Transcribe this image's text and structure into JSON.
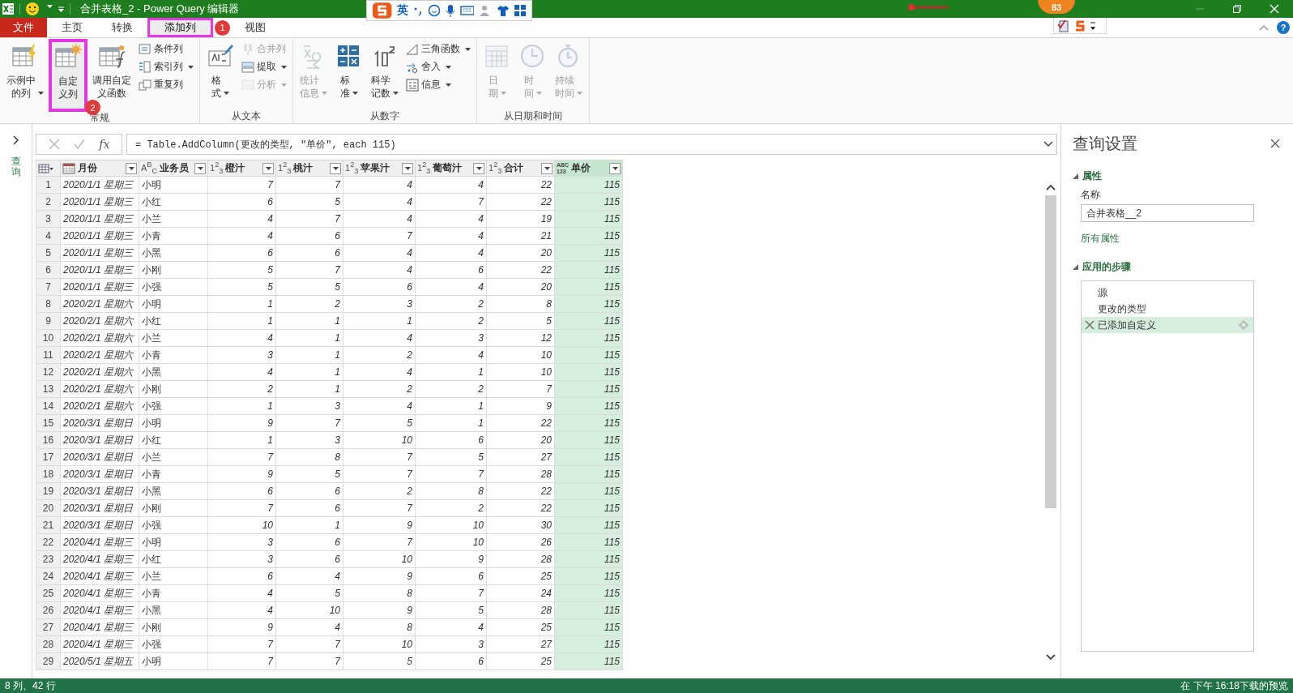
{
  "title_bar": {
    "title": "合并表格_2 - Power Query 编辑器",
    "ime_label": "英",
    "balloon": "83"
  },
  "tabs": [
    {
      "label": "文件",
      "kind": "file",
      "selected": false
    },
    {
      "label": "主页",
      "kind": "tab",
      "selected": false
    },
    {
      "label": "转换",
      "kind": "tab",
      "selected": false
    },
    {
      "label": "添加列",
      "kind": "tab",
      "selected": true,
      "callout": "1"
    },
    {
      "label": "视图",
      "kind": "tab",
      "selected": false
    }
  ],
  "help": "?",
  "ribbon": {
    "groups": [
      {
        "label": "常规",
        "items": [
          {
            "kind": "large",
            "label": "示例中的列",
            "dropdown": true,
            "disabled": false
          },
          {
            "kind": "large",
            "label": "自定义列",
            "dropdown": false,
            "disabled": false,
            "callout": "2"
          },
          {
            "kind": "large",
            "label": "调用自定义函数",
            "dropdown": false,
            "disabled": false
          },
          {
            "kind": "small",
            "label": "条件列",
            "dropdown": false,
            "disabled": false
          },
          {
            "kind": "small",
            "label": "索引列",
            "dropdown": true,
            "disabled": false
          },
          {
            "kind": "small",
            "label": "重复列",
            "dropdown": false,
            "disabled": false
          }
        ]
      },
      {
        "label": "从文本",
        "items": [
          {
            "kind": "large",
            "label": "格式",
            "dropdown": true,
            "disabled": false
          },
          {
            "kind": "small",
            "label": "合并列",
            "dropdown": false,
            "disabled": true
          },
          {
            "kind": "small",
            "label": "提取",
            "dropdown": true,
            "disabled": false
          },
          {
            "kind": "small",
            "label": "分析",
            "dropdown": true,
            "disabled": true
          }
        ]
      },
      {
        "label": "从数字",
        "items": [
          {
            "kind": "large",
            "label": "统计信息",
            "dropdown": true,
            "disabled": true
          },
          {
            "kind": "large",
            "label": "标准",
            "dropdown": true,
            "disabled": false
          },
          {
            "kind": "large",
            "label": "科学记数",
            "dropdown": true,
            "disabled": false
          },
          {
            "kind": "small",
            "label": "三角函数",
            "dropdown": true,
            "disabled": false
          },
          {
            "kind": "small",
            "label": "舍入",
            "dropdown": true,
            "disabled": false
          },
          {
            "kind": "small",
            "label": "信息",
            "dropdown": true,
            "disabled": false
          }
        ]
      },
      {
        "label": "从日期和时间",
        "items": [
          {
            "kind": "large",
            "label": "日期",
            "dropdown": true,
            "disabled": true
          },
          {
            "kind": "large",
            "label": "时间",
            "dropdown": true,
            "disabled": true
          },
          {
            "kind": "large",
            "label": "持续时间",
            "dropdown": true,
            "disabled": true
          }
        ]
      }
    ]
  },
  "queries_pane": {
    "label": "查询"
  },
  "formula_bar": {
    "fx": "fx",
    "formula": "= Table.AddColumn(更改的类型, \"单价\", each 115)"
  },
  "table": {
    "columns": [
      {
        "name": "月份",
        "kind": "date",
        "selected": false
      },
      {
        "name": "业务员",
        "kind": "text",
        "type_label": "A$^{B}$$_{C}$",
        "selected": false
      },
      {
        "name": "橙汁",
        "kind": "number",
        "type_label": "1$^{2}$$_{3}$",
        "selected": false
      },
      {
        "name": "桃汁",
        "kind": "number",
        "type_label": "1$^{2}$$_{3}$",
        "selected": false
      },
      {
        "name": "苹果汁",
        "kind": "number",
        "type_label": "1$^{2}$$_{3}$",
        "selected": false
      },
      {
        "name": "葡萄汁",
        "kind": "number",
        "type_label": "1$^{2}$$_{3}$",
        "selected": false
      },
      {
        "name": "合计",
        "kind": "number",
        "type_label": "1$^{2}$$_{3}$",
        "selected": false
      },
      {
        "name": "单价",
        "kind": "any",
        "type_label": "ABC\n123",
        "selected": true
      }
    ],
    "rows": [
      {
        "row_number": "1",
        "cells": [
          "2020/1/1 星期三",
          "小明",
          "7",
          "7",
          "4",
          "4",
          "22",
          "115"
        ]
      },
      {
        "row_number": "2",
        "cells": [
          "2020/1/1 星期三",
          "小红",
          "6",
          "5",
          "4",
          "7",
          "22",
          "115"
        ]
      },
      {
        "row_number": "3",
        "cells": [
          "2020/1/1 星期三",
          "小兰",
          "4",
          "7",
          "4",
          "4",
          "19",
          "115"
        ]
      },
      {
        "row_number": "4",
        "cells": [
          "2020/1/1 星期三",
          "小青",
          "4",
          "6",
          "7",
          "4",
          "21",
          "115"
        ]
      },
      {
        "row_number": "5",
        "cells": [
          "2020/1/1 星期三",
          "小黑",
          "6",
          "6",
          "4",
          "4",
          "20",
          "115"
        ]
      },
      {
        "row_number": "6",
        "cells": [
          "2020/1/1 星期三",
          "小刚",
          "5",
          "7",
          "4",
          "6",
          "22",
          "115"
        ]
      },
      {
        "row_number": "7",
        "cells": [
          "2020/1/1 星期三",
          "小强",
          "5",
          "5",
          "6",
          "4",
          "20",
          "115"
        ]
      },
      {
        "row_number": "8",
        "cells": [
          "2020/2/1 星期六",
          "小明",
          "1",
          "2",
          "3",
          "2",
          "8",
          "115"
        ]
      },
      {
        "row_number": "9",
        "cells": [
          "2020/2/1 星期六",
          "小红",
          "1",
          "1",
          "1",
          "2",
          "5",
          "115"
        ]
      },
      {
        "row_number": "10",
        "cells": [
          "2020/2/1 星期六",
          "小兰",
          "4",
          "1",
          "4",
          "3",
          "12",
          "115"
        ]
      },
      {
        "row_number": "11",
        "cells": [
          "2020/2/1 星期六",
          "小青",
          "3",
          "1",
          "2",
          "4",
          "10",
          "115"
        ]
      },
      {
        "row_number": "12",
        "cells": [
          "2020/2/1 星期六",
          "小黑",
          "4",
          "1",
          "4",
          "1",
          "10",
          "115"
        ]
      },
      {
        "row_number": "13",
        "cells": [
          "2020/2/1 星期六",
          "小刚",
          "2",
          "1",
          "2",
          "2",
          "7",
          "115"
        ]
      },
      {
        "row_number": "14",
        "cells": [
          "2020/2/1 星期六",
          "小强",
          "1",
          "3",
          "4",
          "1",
          "9",
          "115"
        ]
      },
      {
        "row_number": "15",
        "cells": [
          "2020/3/1 星期日",
          "小明",
          "9",
          "7",
          "5",
          "1",
          "22",
          "115"
        ]
      },
      {
        "row_number": "16",
        "cells": [
          "2020/3/1 星期日",
          "小红",
          "1",
          "3",
          "10",
          "6",
          "20",
          "115"
        ]
      },
      {
        "row_number": "17",
        "cells": [
          "2020/3/1 星期日",
          "小兰",
          "7",
          "8",
          "7",
          "5",
          "27",
          "115"
        ]
      },
      {
        "row_number": "18",
        "cells": [
          "2020/3/1 星期日",
          "小青",
          "9",
          "5",
          "7",
          "7",
          "28",
          "115"
        ]
      },
      {
        "row_number": "19",
        "cells": [
          "2020/3/1 星期日",
          "小黑",
          "6",
          "6",
          "2",
          "8",
          "22",
          "115"
        ]
      },
      {
        "row_number": "20",
        "cells": [
          "2020/3/1 星期日",
          "小刚",
          "7",
          "6",
          "7",
          "2",
          "22",
          "115"
        ]
      },
      {
        "row_number": "21",
        "cells": [
          "2020/3/1 星期日",
          "小强",
          "10",
          "1",
          "9",
          "10",
          "30",
          "115"
        ]
      },
      {
        "row_number": "22",
        "cells": [
          "2020/4/1 星期三",
          "小明",
          "3",
          "6",
          "7",
          "10",
          "26",
          "115"
        ]
      },
      {
        "row_number": "23",
        "cells": [
          "2020/4/1 星期三",
          "小红",
          "3",
          "6",
          "10",
          "9",
          "28",
          "115"
        ]
      },
      {
        "row_number": "24",
        "cells": [
          "2020/4/1 星期三",
          "小兰",
          "6",
          "4",
          "9",
          "6",
          "25",
          "115"
        ]
      },
      {
        "row_number": "25",
        "cells": [
          "2020/4/1 星期三",
          "小青",
          "4",
          "5",
          "8",
          "7",
          "24",
          "115"
        ]
      },
      {
        "row_number": "26",
        "cells": [
          "2020/4/1 星期三",
          "小黑",
          "4",
          "10",
          "9",
          "5",
          "28",
          "115"
        ]
      },
      {
        "row_number": "27",
        "cells": [
          "2020/4/1 星期三",
          "小刚",
          "9",
          "4",
          "8",
          "4",
          "25",
          "115"
        ]
      },
      {
        "row_number": "28",
        "cells": [
          "2020/4/1 星期三",
          "小强",
          "7",
          "7",
          "10",
          "3",
          "27",
          "115"
        ]
      },
      {
        "row_number": "29",
        "cells": [
          "2020/5/1 星期五",
          "小明",
          "7",
          "7",
          "5",
          "6",
          "25",
          "115"
        ]
      }
    ]
  },
  "settings": {
    "title": "查询设置",
    "properties": {
      "heading": "属性",
      "expanded": true,
      "name_label": "名称",
      "name_value": "合并表格__2",
      "all_link": "所有属性"
    },
    "steps": {
      "heading": "应用的步骤",
      "expanded": true,
      "items": [
        {
          "label": "源",
          "selected": false
        },
        {
          "label": "更改的类型",
          "selected": false
        },
        {
          "label": "已添加自定义",
          "selected": true
        }
      ]
    }
  },
  "status_bar": {
    "left": "8 列、42 行",
    "right": "在 下午 16:18下载的预览"
  }
}
